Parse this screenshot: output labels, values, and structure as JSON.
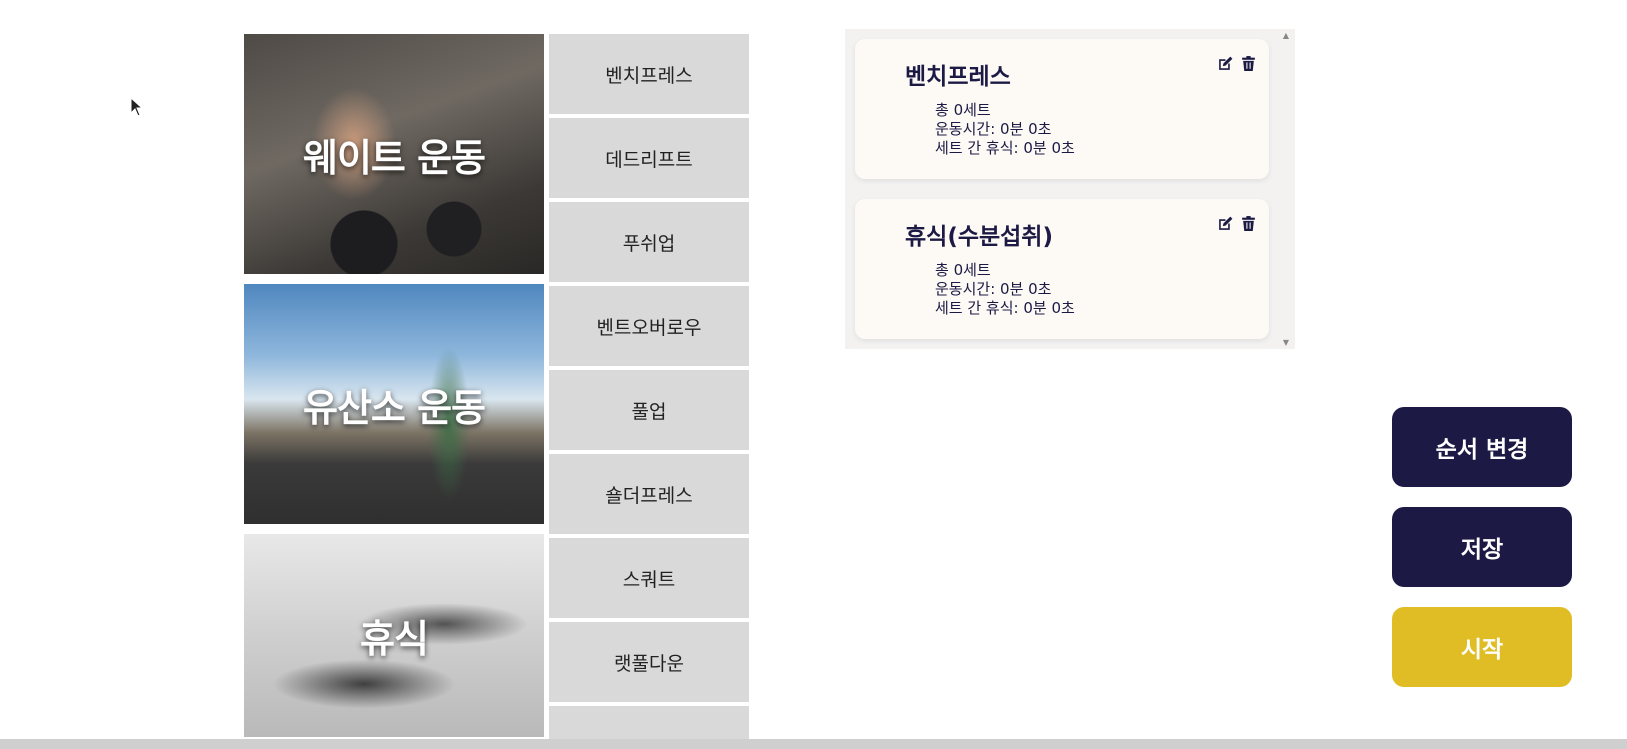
{
  "categories": [
    {
      "label": "웨이트 운동"
    },
    {
      "label": "유산소 운동"
    },
    {
      "label": "휴식"
    }
  ],
  "exercises": [
    {
      "label": "벤치프레스"
    },
    {
      "label": "데드리프트"
    },
    {
      "label": "푸쉬업"
    },
    {
      "label": "벤트오버로우"
    },
    {
      "label": "풀업"
    },
    {
      "label": "숄더프레스"
    },
    {
      "label": "스쿼트"
    },
    {
      "label": "랫풀다운"
    },
    {
      "label": ""
    }
  ],
  "routine": {
    "items": [
      {
        "title": "벤치프레스",
        "sets": "총 0세트",
        "duration": "운동시간: 0분 0초",
        "rest": "세트 간 휴식: 0분 0초"
      },
      {
        "title": "휴식(수분섭취)",
        "sets": "총 0세트",
        "duration": "운동시간: 0분 0초",
        "rest": "세트 간 휴식: 0분 0초"
      }
    ]
  },
  "actions": {
    "reorder": "순서 변경",
    "save": "저장",
    "start": "시작"
  },
  "colors": {
    "navy": "#1c1a44",
    "gold": "#e0bd25",
    "exercise_bg": "#d9d9d9"
  }
}
